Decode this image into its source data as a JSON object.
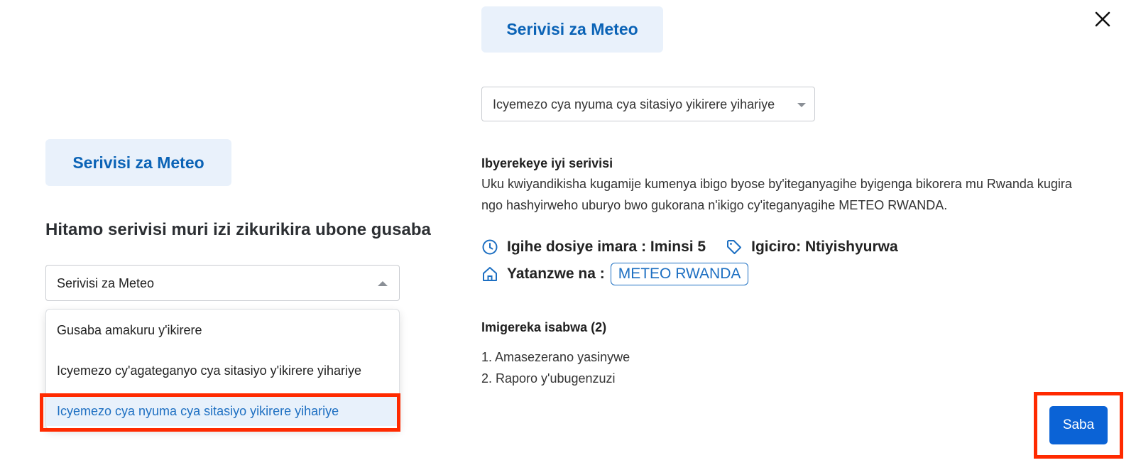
{
  "left_panel": {
    "chip_label": "Serivisi za Meteo",
    "heading": "Hitamo serivisi muri izi zikurikira ubone gusaba",
    "select": {
      "value": "Serivisi za Meteo"
    },
    "dropdown": {
      "options": [
        "Gusaba amakuru y'ikirere",
        "Icyemezo cy'agateganyo cya sitasiyo y'ikirere yihariye",
        "Icyemezo cya nyuma cya sitasiyo yikirere yihariye"
      ],
      "highlighted_index": 2
    }
  },
  "right_panel": {
    "chip_label": "Serivisi za Meteo",
    "select": {
      "value": "Icyemezo cya nyuma cya sitasiyo yikirere yihariye"
    },
    "about": {
      "title": "Ibyerekeye iyi serivisi",
      "description": "Uku kwiyandikisha kugamije kumenya ibigo byose by'iteganyagihe byigenga bikorera mu Rwanda kugira ngo hashyirweho uburyo bwo gukorana n'ikigo cy'iteganyagihe METEO RWANDA."
    },
    "meta": {
      "duration": "Igihe dosiye imara : Iminsi 5",
      "price": "Igiciro: Ntiyishyurwa",
      "provider_label": "Yatanzwe na :",
      "provider": "METEO RWANDA"
    },
    "requirements": {
      "title": "Imigereka isabwa (2)",
      "items": [
        "1. Amasezerano yasinywe",
        "2. Raporo y'ubugenzuzi"
      ]
    },
    "submit_label": "Saba"
  },
  "colors": {
    "accent": "#0b63d6",
    "chip_bg": "#e9f1fb",
    "highlight_red": "#ff2a00"
  }
}
